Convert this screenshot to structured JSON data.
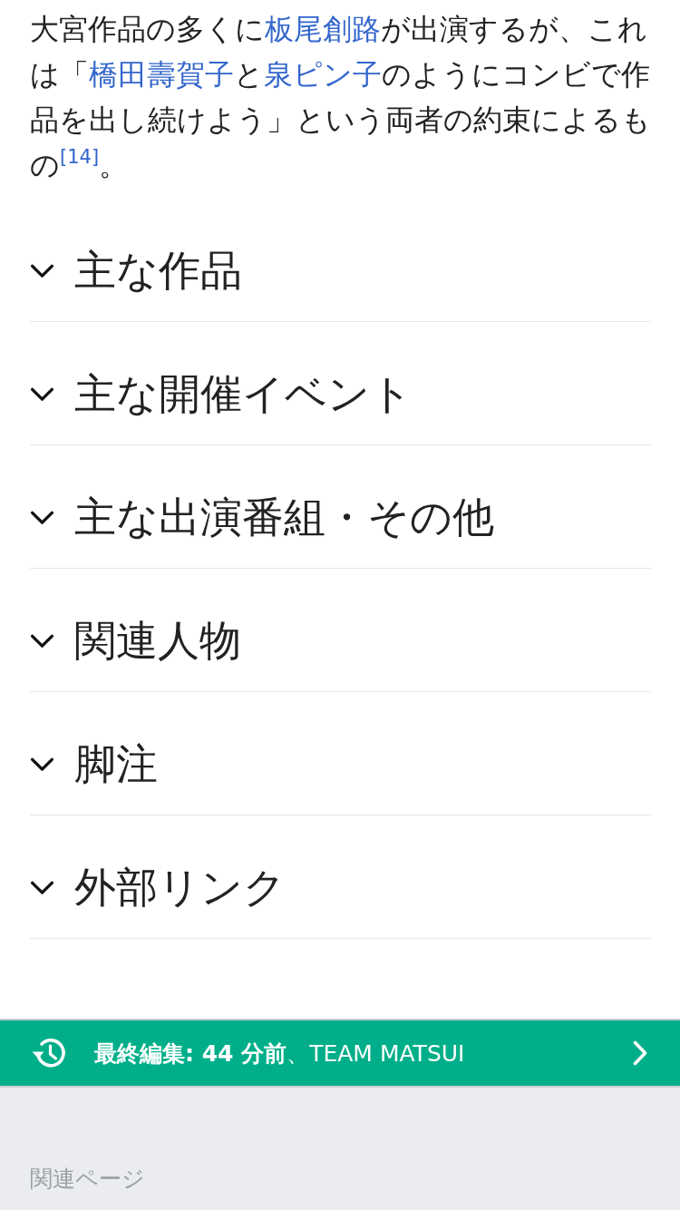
{
  "paragraph": [
    {
      "kind": "text",
      "text": "大宮作品の多くに"
    },
    {
      "kind": "link",
      "text": "板尾創路"
    },
    {
      "kind": "text",
      "text": "が出演するが、これは「"
    },
    {
      "kind": "link",
      "text": "橋田壽賀子"
    },
    {
      "kind": "text",
      "text": "と"
    },
    {
      "kind": "link",
      "text": "泉ピン子"
    },
    {
      "kind": "text",
      "text": "のようにコンビで作品を出し続けよう」という両者の約束によるもの"
    },
    {
      "kind": "ref",
      "text": "[14]"
    },
    {
      "kind": "text",
      "text": "。"
    }
  ],
  "sections": [
    {
      "title": "主な作品",
      "expanded": false
    },
    {
      "title": "主な開催イベント",
      "expanded": false
    },
    {
      "title": "主な出演番組・その他",
      "expanded": false
    },
    {
      "title": "関連人物",
      "expanded": false
    },
    {
      "title": "脚注",
      "expanded": false
    },
    {
      "title": "外部リンク",
      "expanded": false
    }
  ],
  "last_edited": {
    "text": "**最終編集: 44 分前**、TEAM MATSUI"
  },
  "footer": {
    "heading": "関連ページ"
  }
}
